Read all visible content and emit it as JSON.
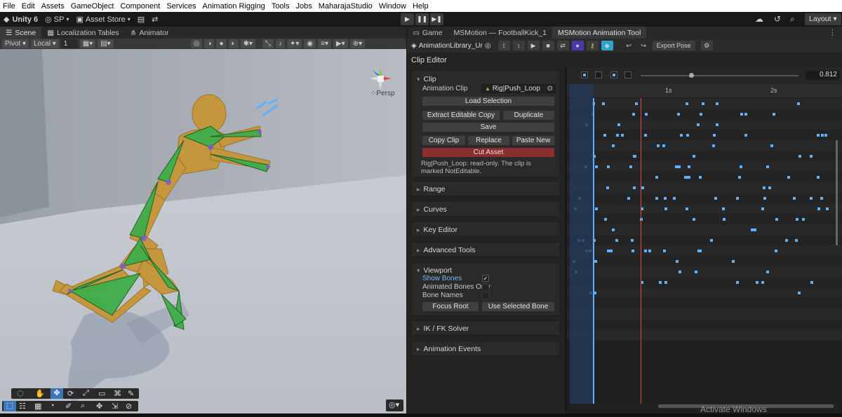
{
  "menu": [
    "File",
    "Edit",
    "Assets",
    "GameObject",
    "Component",
    "Services",
    "Animation Rigging",
    "Tools",
    "Jobs",
    "MaharajaStudio",
    "Window",
    "Help"
  ],
  "toolbar": {
    "unity": "Unity 6",
    "sp": "SP",
    "asset_store": "Asset Store",
    "layout": "Layout"
  },
  "scene_tabs": [
    "Scene",
    "Localization Tables",
    "Animator"
  ],
  "right_tabs": [
    "Game",
    "MSMotion — FootballKick_1",
    "MSMotion Animation Tool"
  ],
  "scene_tools": {
    "pivot": "Pivot",
    "local": "Local",
    "grid": "1",
    "persp": "Persp"
  },
  "ms_toolbar": {
    "library": "AnimationLibrary_Ur",
    "export": "Export Pose"
  },
  "clip_editor": {
    "header": "Clip Editor",
    "clip": {
      "title": "Clip",
      "animation_clip_label": "Animation Clip",
      "animation_clip_value": "Rig|Push_Loop",
      "load_selection": "Load Selection",
      "extract": "Extract Editable Copy",
      "duplicate": "Duplicate",
      "save": "Save",
      "copy_clip": "Copy Clip",
      "replace": "Replace",
      "paste_new": "Paste New",
      "cut_asset": "Cut Asset",
      "note": "Rig|Push_Loop: read-only. The clip is marked NotEditable."
    },
    "sections": [
      "Range",
      "Curves",
      "Key Editor",
      "Advanced Tools"
    ],
    "viewport": {
      "title": "Viewport",
      "show_bones": "Show Bones",
      "animated_bones_only": "Animated Bones Only",
      "bone_names": "Bone Names",
      "focus_root": "Focus Root",
      "use_selected_bone": "Use Selected Bone"
    },
    "sections_after": [
      "IK / FK Solver",
      "Animation Events"
    ]
  },
  "timeline": {
    "value": "0.812",
    "tick_1": "1s",
    "tick_2": "2s"
  },
  "watermark": "Activate Windows",
  "colors": {
    "accent": "#5fb1ff",
    "playhead": "#e04a4a",
    "cut": "#8b2e2e"
  }
}
